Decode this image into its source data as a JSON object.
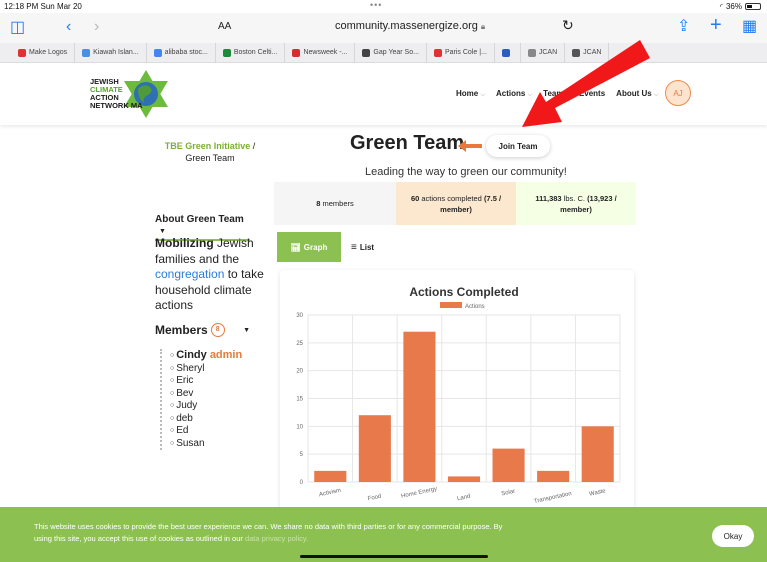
{
  "status": {
    "time": "12:18 PM",
    "date": "Sun Mar 20",
    "battery": "36%"
  },
  "browser": {
    "text_size": "AA",
    "url": "community.massenergize.org",
    "bookmarks": [
      {
        "label": "Make Logos",
        "color": "#d33"
      },
      {
        "label": "Kiawah Islan...",
        "color": "#4a90e2"
      },
      {
        "label": "alibaba stoc...",
        "color": "#4285f4"
      },
      {
        "label": "Boston Celti...",
        "color": "#1e8a3a"
      },
      {
        "label": "Newsweek -...",
        "color": "#d32f2f"
      },
      {
        "label": "Gap Year So...",
        "color": "#444"
      },
      {
        "label": "Paris Cole |...",
        "color": "#d33"
      },
      {
        "label": "",
        "color": "#2a5dbf"
      },
      {
        "label": "JCAN",
        "color": "#888"
      },
      {
        "label": "JCAN",
        "color": "#555"
      }
    ]
  },
  "site": {
    "logo_lines": [
      "JEWISH",
      "CLIMATE",
      "ACTION",
      "NETWORK MA"
    ],
    "nav": [
      {
        "label": "Home"
      },
      {
        "label": "Actions"
      },
      {
        "label": "Teams"
      },
      {
        "label": "Events"
      },
      {
        "label": "About Us"
      }
    ],
    "avatar_initials": "AJ"
  },
  "team": {
    "breadcrumb_parent": "TBE Green Initiative",
    "breadcrumb_sep": "/",
    "breadcrumb_current": "Green Team",
    "title": "Green Team",
    "join_label": "Join Team",
    "subtitle": "Leading the way to green our community!",
    "stats": {
      "members_count": "8",
      "members_label": "members",
      "actions_count": "60",
      "actions_label": "actions completed",
      "actions_per": "(7.5 / member)",
      "co2_value": "111,383",
      "co2_label": "lbs. C.",
      "co2_per": "(13,923 / member)"
    },
    "tabs": {
      "graph": "Graph",
      "list": "List"
    },
    "about_header": "About Green Team",
    "about_bold": "Mobilizing",
    "about_text1": " Jewish families and the ",
    "about_link": "congregation",
    "about_text2": " to take household climate actions",
    "members_header": "Members",
    "members_count": "8",
    "members": [
      {
        "name": "Cindy",
        "role": "admin"
      },
      {
        "name": "Sheryl"
      },
      {
        "name": "Eric"
      },
      {
        "name": "Bev"
      },
      {
        "name": "Judy"
      },
      {
        "name": "deb"
      },
      {
        "name": "Ed"
      },
      {
        "name": "Susan"
      }
    ]
  },
  "cookie": {
    "text": "This website uses cookies to provide the best user experience we can. We share no data with third parties or for any commercial purpose. By using this site, you accept this use of cookies as outlined in our ",
    "link": "data privacy policy.",
    "button": "Okay"
  },
  "colors": {
    "accent_green": "#8cc152",
    "accent_orange": "#e8793c",
    "link_blue": "#2a7dd6"
  },
  "chart_data": {
    "type": "bar",
    "title": "Actions Completed",
    "categories": [
      "Activism",
      "Food",
      "Home Energy",
      "Land",
      "Solar",
      "Transportation",
      "Waste"
    ],
    "series": [
      {
        "name": "Actions",
        "values": [
          2,
          12,
          27,
          1,
          6,
          2,
          10
        ],
        "color": "#e8794a"
      }
    ],
    "ylim": [
      0,
      30
    ],
    "yticks": [
      0,
      5,
      10,
      15,
      20,
      25,
      30
    ],
    "grid": true,
    "legend": "top"
  }
}
